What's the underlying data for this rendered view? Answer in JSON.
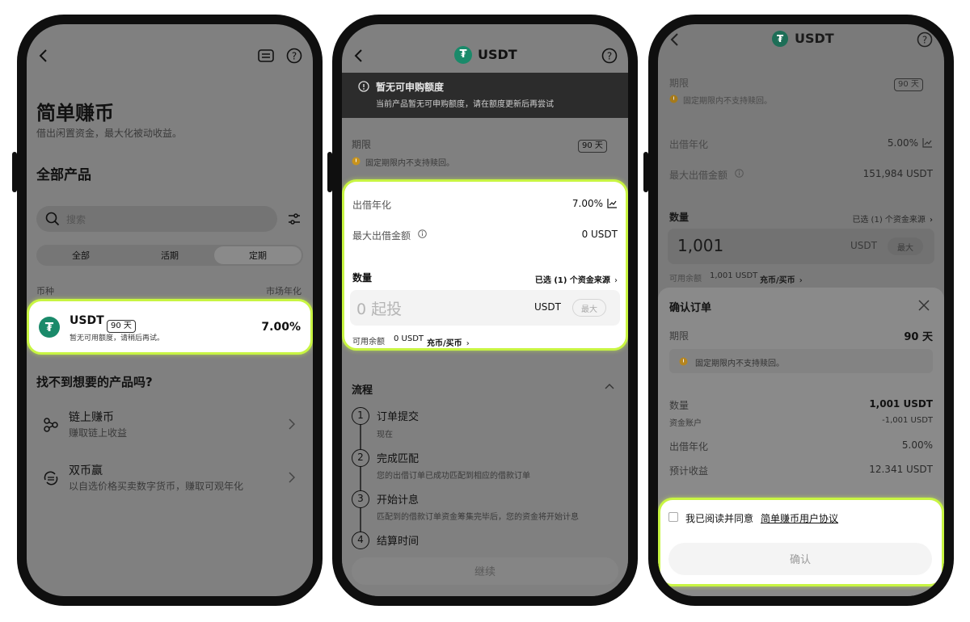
{
  "screen1": {
    "page_title": "简单赚币",
    "subtitle": "借出闲置资金，最大化被动收益。",
    "section_title": "全部产品",
    "search_placeholder": "搜索",
    "tabs": [
      "全部",
      "活期",
      "定期"
    ],
    "active_tab": "定期",
    "col_coin": "币种",
    "col_rate": "市场年化",
    "product": {
      "coin": "USDT",
      "days": "90 天",
      "note": "暂无可用额度，请稍后再试。",
      "rate": "7.00%"
    },
    "more_title": "找不到想要的产品吗?",
    "links": [
      {
        "title": "链上赚币",
        "desc": "赚取链上收益"
      },
      {
        "title": "双币赢",
        "desc": "以自选价格买卖数字货币，赚取可观年化"
      }
    ]
  },
  "screen2": {
    "title": "USDT",
    "banner_title": "暂无可申购额度",
    "banner_desc": "当前产品暂无可申购额度，请在额度更新后再尝试",
    "term_label": "期限",
    "term_days": "90 天",
    "term_note": "固定期限内不支持赎回。",
    "apr_label": "出借年化",
    "apr_value": "7.00%",
    "max_label": "最大出借金额",
    "max_value": "0 USDT",
    "qty_label": "数量",
    "source_link": "已选 (1) 个资金来源",
    "qty_placeholder": "0 起投",
    "unit": "USDT",
    "max_button": "最大",
    "balance_label": "可用余额",
    "balance_value": "0 USDT",
    "balance_link": "充币/买币",
    "flow_title": "流程",
    "steps": [
      {
        "num": "1",
        "title": "订单提交",
        "desc": "现在"
      },
      {
        "num": "2",
        "title": "完成匹配",
        "desc": "您的出借订单已成功匹配到相应的借款订单"
      },
      {
        "num": "3",
        "title": "开始计息",
        "desc": "匹配到的借款订单资金筹集完毕后，您的资金将开始计息"
      },
      {
        "num": "4",
        "title": "结算时间",
        "desc": ""
      }
    ],
    "continue_button": "继续"
  },
  "screen3": {
    "title": "USDT",
    "term_label": "期限",
    "term_days": "90 天",
    "term_note": "固定期限内不支持赎回。",
    "apr_label": "出借年化",
    "apr_value": "5.00%",
    "max_label": "最大出借金额",
    "max_value": "151,984 USDT",
    "qty_label": "数量",
    "source_link": "已选 (1) 个资金来源",
    "qty_value": "1,001",
    "unit": "USDT",
    "max_button": "最大",
    "balance_label": "可用余额",
    "balance_value": "1,001 USDT",
    "balance_link": "充币/买币",
    "sheet": {
      "title": "确认订单",
      "term_label": "期限",
      "term_value": "90 天",
      "term_note": "固定期限内不支持赎回。",
      "qty_label": "数量",
      "qty_value": "1,001 USDT",
      "account_label": "资金账户",
      "account_value": "-1,001 USDT",
      "apr_label": "出借年化",
      "apr_value": "5.00%",
      "earn_label": "预计收益",
      "earn_value": "12.341 USDT",
      "agree_text": "我已阅读并同意",
      "agree_link": "简单赚币用户协议",
      "confirm_button": "确认"
    }
  }
}
